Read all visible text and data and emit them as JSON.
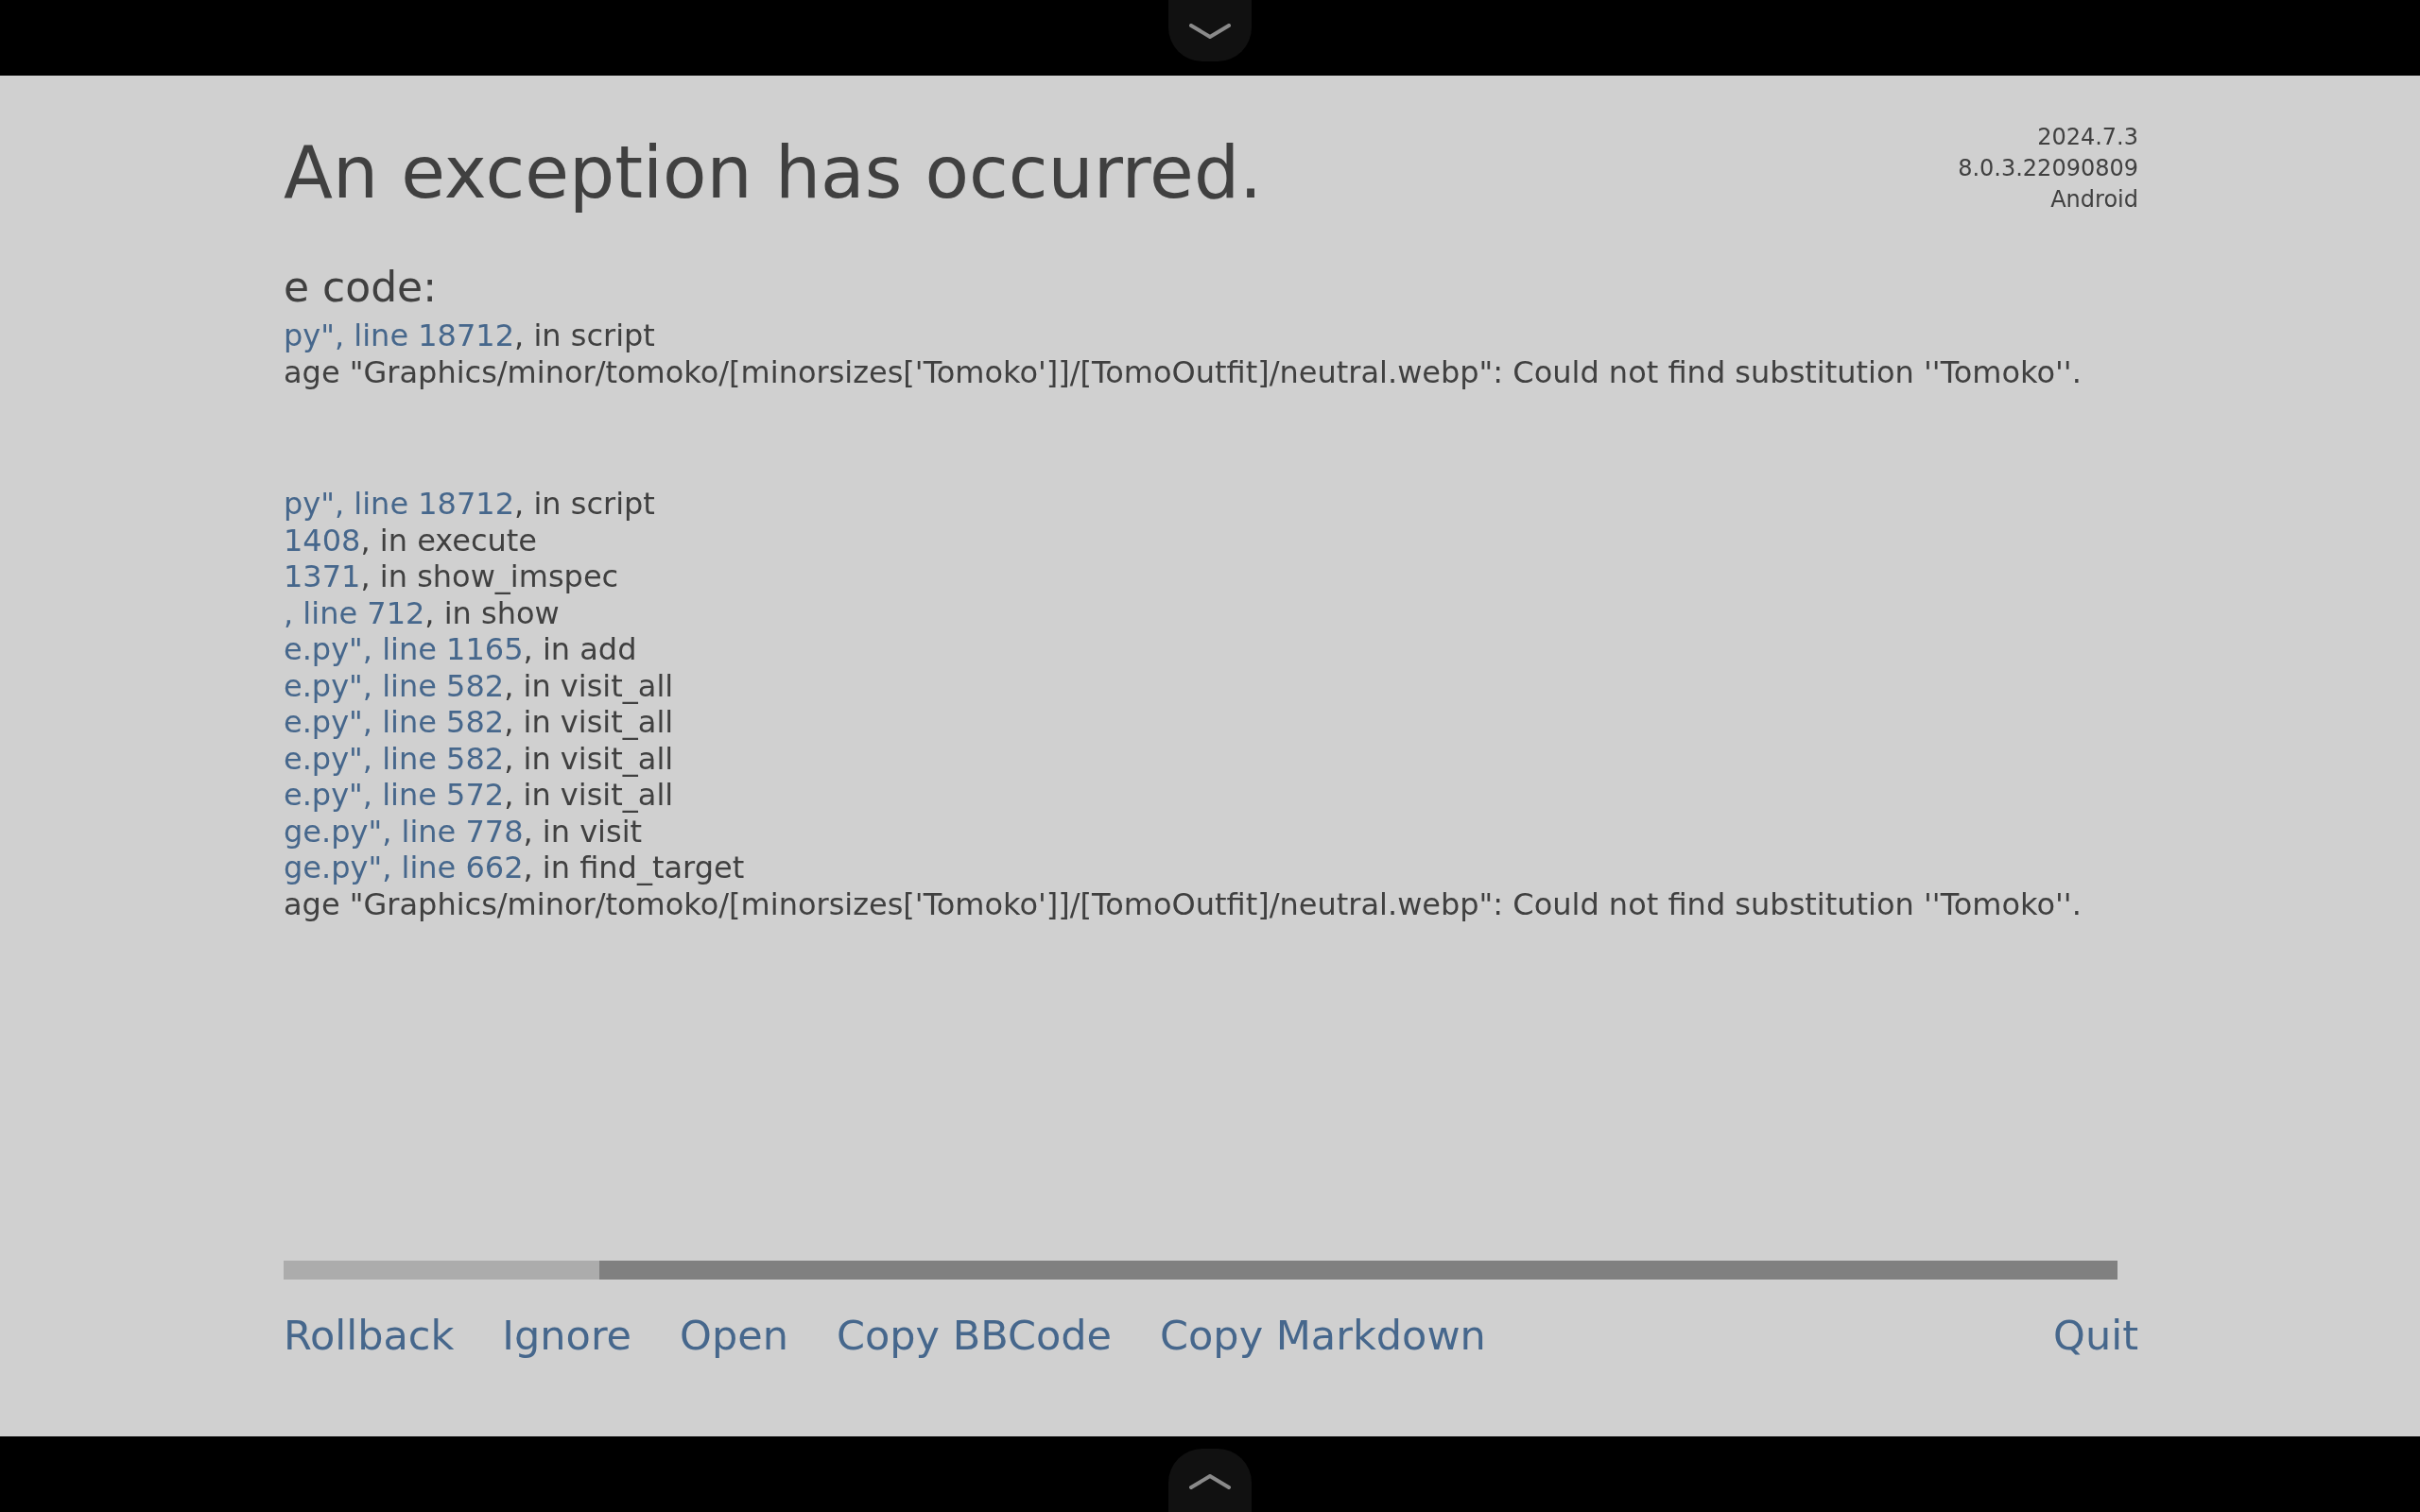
{
  "header": {
    "title": "An exception has occurred.",
    "version_info": [
      "2024.7.3",
      "8.0.3.22090809",
      "Android"
    ]
  },
  "traceback": {
    "heading": "e code:",
    "blocks": [
      {
        "lines": [
          {
            "file": "py\", line 18712",
            "text": ", in script"
          },
          {
            "text": "age \"Graphics/minor/tomoko/[minorsizes['Tomoko']]/[TomoOutfit]/neutral.webp\": Could not find substitution ''Tomoko''."
          }
        ]
      },
      {
        "lines": [
          {
            "file": "py\", line 18712",
            "text": ", in script"
          },
          {
            "file": "1408",
            "text": ", in execute"
          },
          {
            "file": "1371",
            "text": ", in show_imspec"
          },
          {
            "file": ", line 712",
            "text": ", in show"
          },
          {
            "file": "e.py\", line 1165",
            "text": ", in add"
          },
          {
            "file": "e.py\", line 582",
            "text": ", in visit_all"
          },
          {
            "file": "e.py\", line 582",
            "text": ", in visit_all"
          },
          {
            "file": "e.py\", line 582",
            "text": ", in visit_all"
          },
          {
            "file": "e.py\", line 572",
            "text": ", in visit_all"
          },
          {
            "file": "ge.py\", line 778",
            "text": ", in visit"
          },
          {
            "file": "ge.py\", line 662",
            "text": ", in find_target"
          },
          {
            "text": "age \"Graphics/minor/tomoko/[minorsizes['Tomoko']]/[TomoOutfit]/neutral.webp\": Could not find substitution ''Tomoko''."
          }
        ]
      }
    ]
  },
  "actions": [
    "Rollback",
    "Ignore",
    "Open",
    "Copy BBCode",
    "Copy Markdown"
  ],
  "quit": "Quit"
}
